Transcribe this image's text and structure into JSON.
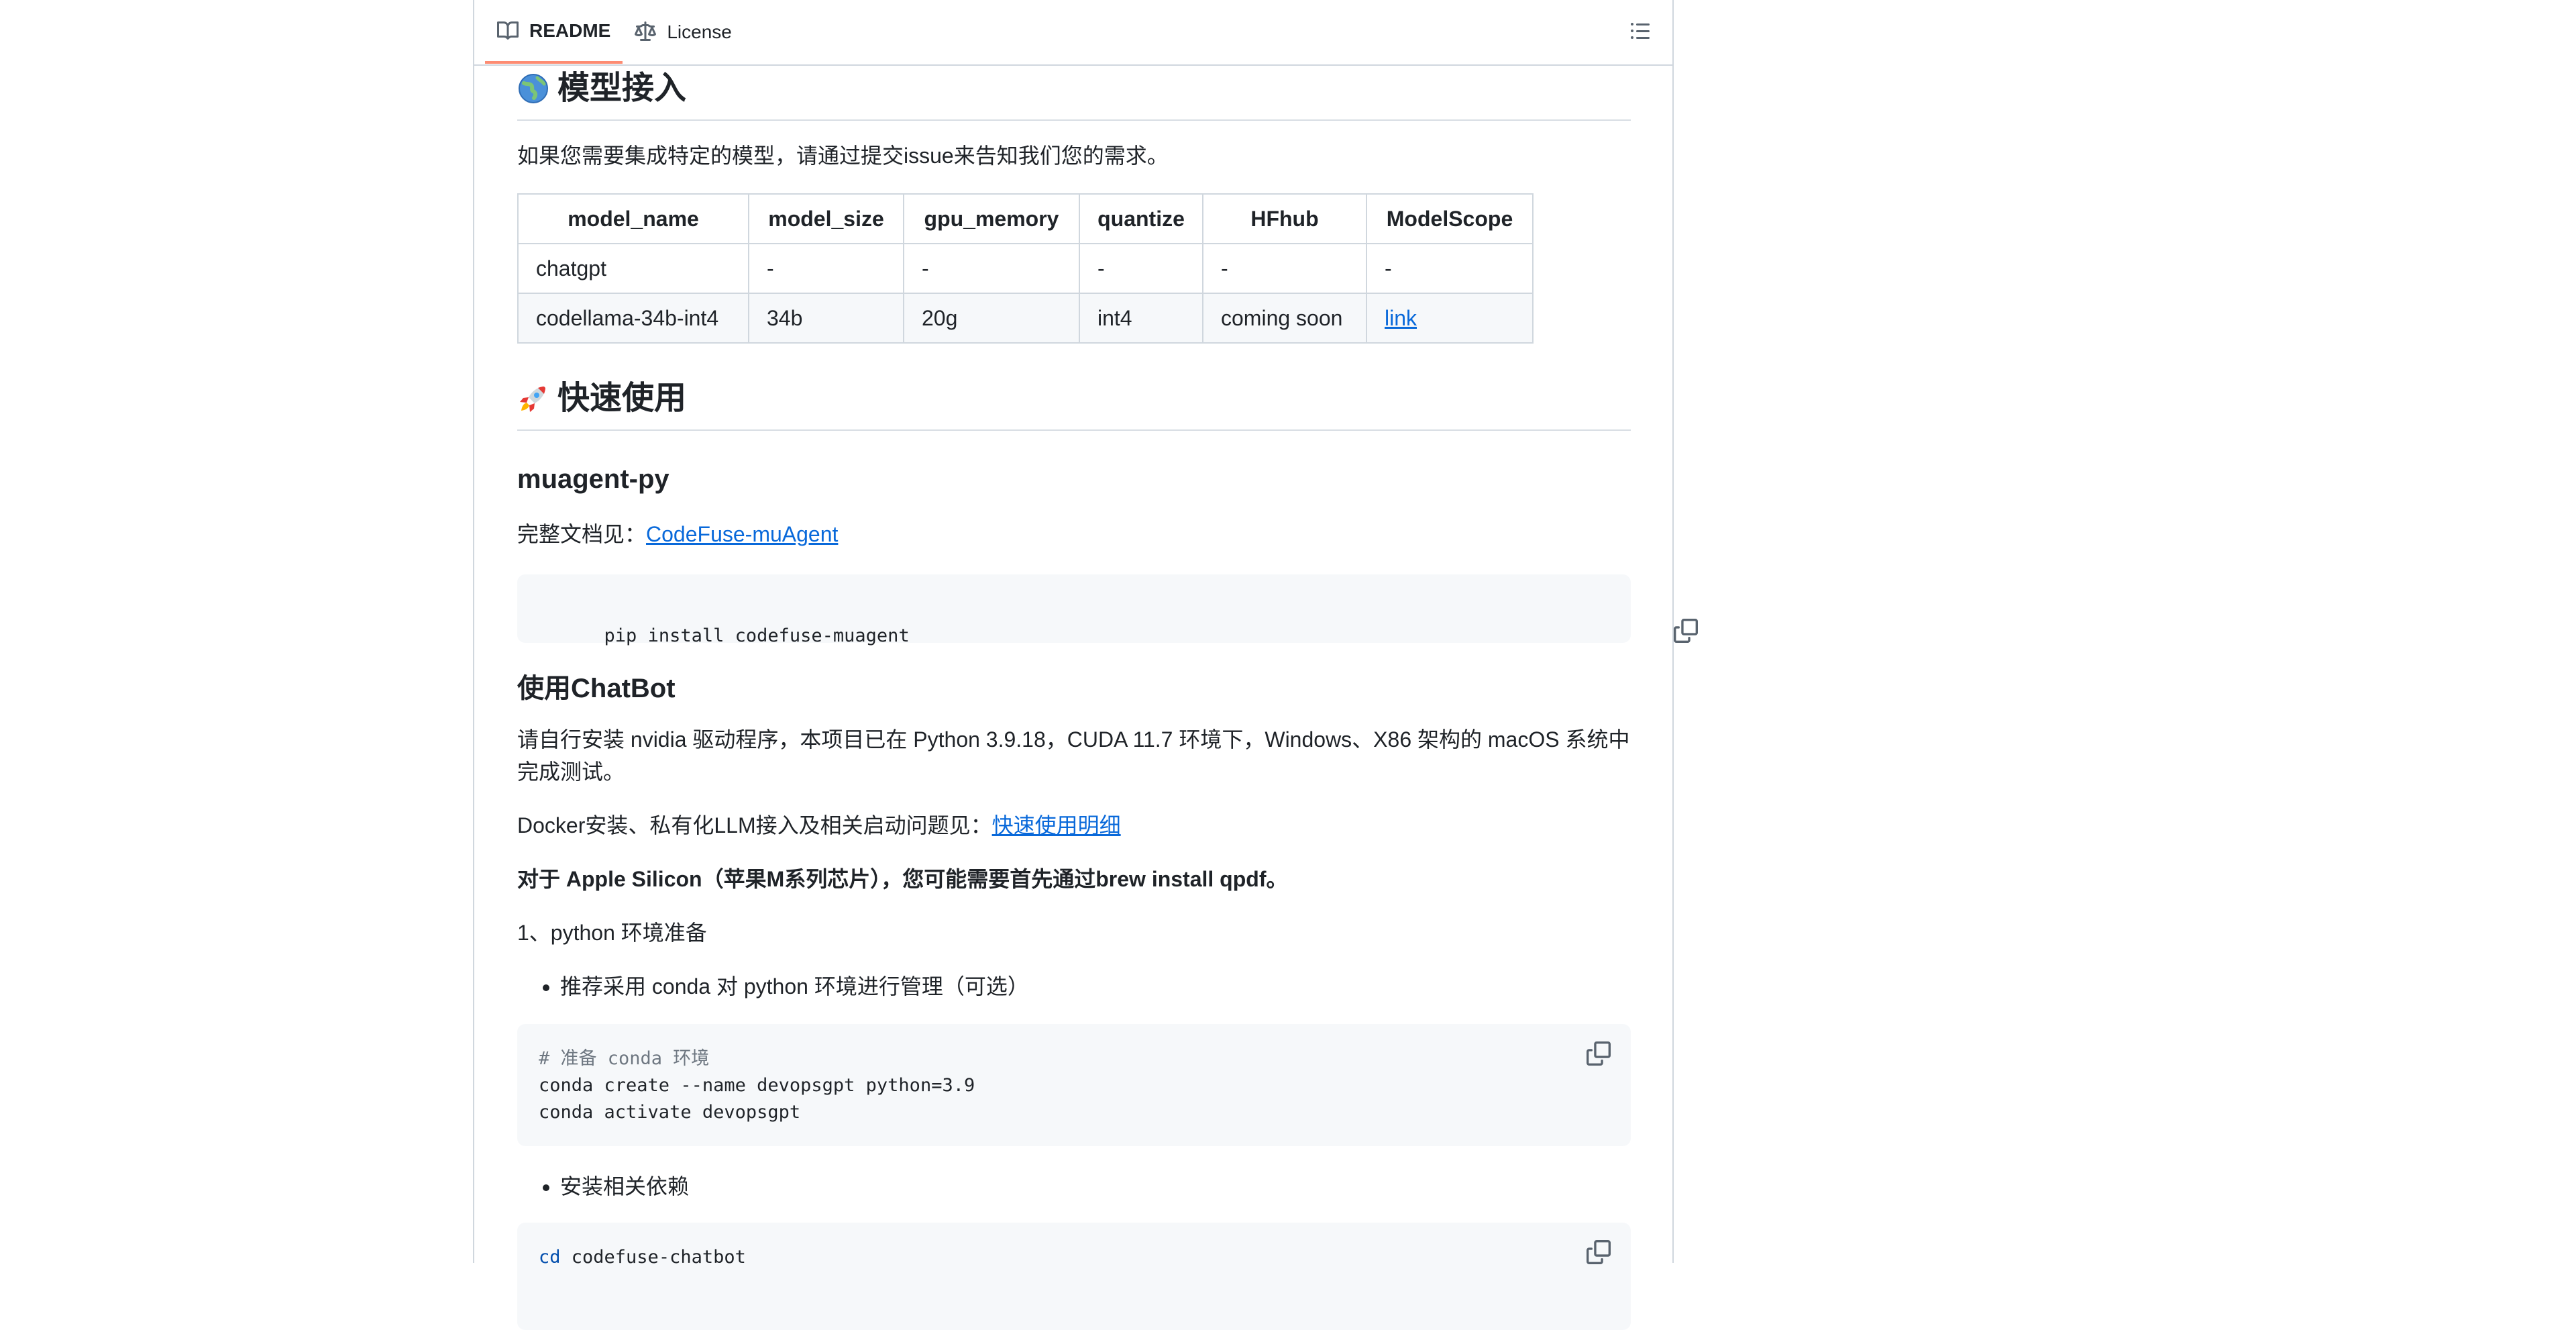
{
  "tabs": {
    "readme_label": "README",
    "license_label": "License",
    "outline_icon": "list-unordered-icon"
  },
  "model_access": {
    "heading": "模型接入",
    "emoji": "globe-icon",
    "intro": "如果您需要集成特定的模型，请通过提交issue来告知我们您的需求。",
    "columns": [
      "model_name",
      "model_size",
      "gpu_memory",
      "quantize",
      "HFhub",
      "ModelScope"
    ],
    "rows": [
      [
        "chatgpt",
        "-",
        "-",
        "-",
        "-",
        "-"
      ],
      [
        "codellama-34b-int4",
        "34b",
        "20g",
        "int4",
        "coming soon",
        "link"
      ]
    ]
  },
  "quick_start": {
    "heading": "快速使用",
    "emoji": "rocket-icon",
    "muagent_heading": "muagent-py",
    "doc_prefix": "完整文档见：",
    "doc_link": "CodeFuse-muAgent",
    "pip_code": "pip install codefuse-muagent",
    "chatbot_heading": "使用ChatBot",
    "env_text": "请自行安装 nvidia 驱动程序，本项目已在 Python 3.9.18，CUDA 11.7 环境下，Windows、X86 架构的 macOS 系统中完成测试。",
    "docker_prefix": "Docker安装、私有化LLM接入及相关启动问题见：",
    "docker_link": "快速使用明细",
    "apple_note": "对于 Apple Silicon（苹果M系列芯片），您可能需要首先通过brew install qpdf。",
    "step1": "1、python 环境准备",
    "bullet_conda": "推荐采用 conda 对 python 环境进行管理（可选）",
    "conda_comment": "# 准备 conda 环境",
    "conda_line1": "conda create --name devopsgpt python=3.9",
    "conda_line2": "conda activate devopsgpt",
    "bullet_deps": "安装相关依赖",
    "cd_keyword": "cd",
    "cd_arg": " codefuse-chatbot"
  }
}
